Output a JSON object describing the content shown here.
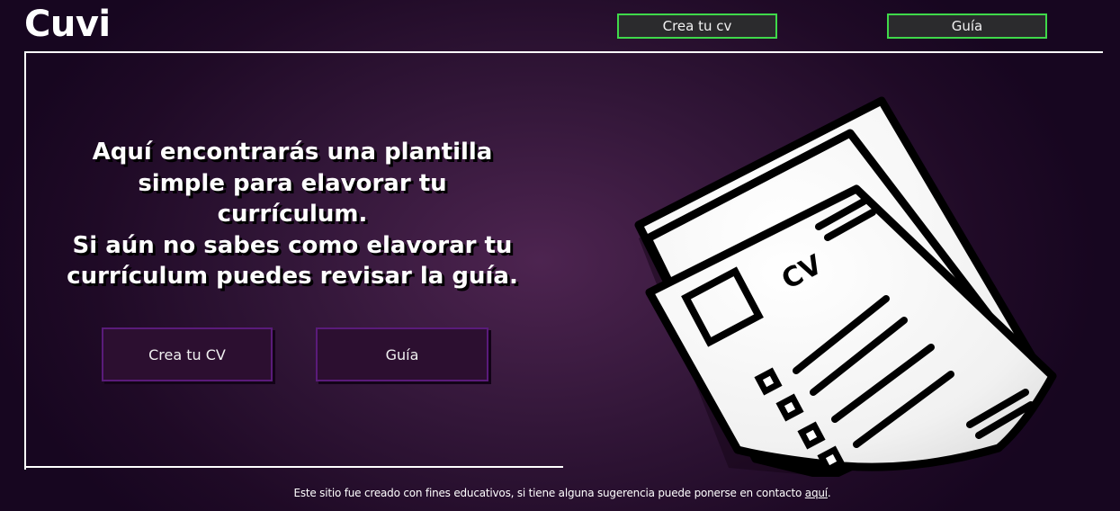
{
  "header": {
    "logo": "Cuvi",
    "nav": {
      "create_cv": "Crea tu cv",
      "guide": "Guía"
    }
  },
  "hero": {
    "lines": [
      "Aquí encontrarás una plantilla",
      "simple para elavorar tu currículum.",
      "Si aún no sabes como elavorar tu",
      "currículum puedes revisar la guía."
    ],
    "buttons": {
      "create_cv": "Crea tu CV",
      "guide": "Guía"
    }
  },
  "illustration": {
    "icon": "cv-documents-illustration",
    "label": "CV"
  },
  "footer": {
    "text": "Este sitio fue creado con fines educativos, si tiene alguna sugerencia puede ponerse en contacto ",
    "link": "aquí",
    "suffix": "."
  },
  "colors": {
    "nav_border": "#3fd94a",
    "nav_bg": "#2b2b2d",
    "cta_border": "#5a1b7a",
    "cta_bg": "#2c0f30",
    "background": "#321638"
  }
}
